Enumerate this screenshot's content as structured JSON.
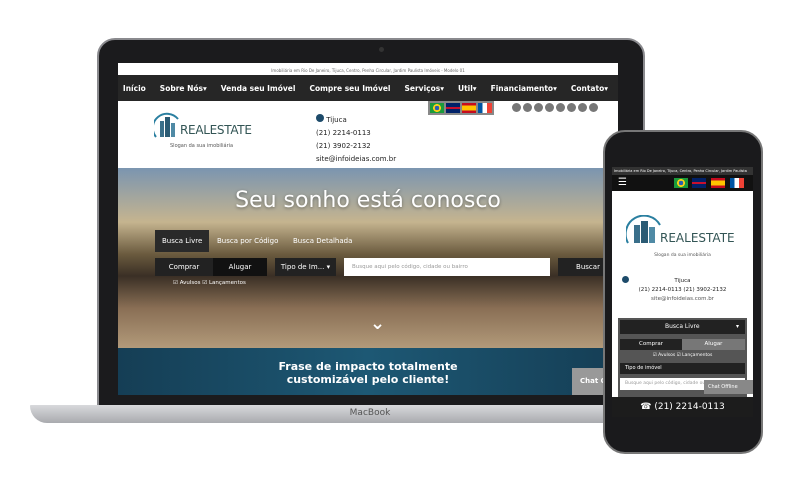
{
  "laptop": {
    "brand": "MacBook",
    "top_strip": "Imobiliária em Rio De Janeiro, Tijuca, Centro, Penha Circular, Jardim Paulista Imóveis - Modelo 01",
    "nav": [
      "Início",
      "Sobre Nós▾",
      "Venda seu Imóvel",
      "Compre seu Imóvel",
      "Serviços▾",
      "Util▾",
      "Financiamento▾",
      "Contato▾"
    ],
    "logo": {
      "text_real": "REAL",
      "text_estate": "ESTATE",
      "slogan": "Slogan da sua imobiliária"
    },
    "contact": {
      "location": "Tijuca",
      "phone1": "(21) 2214-0113",
      "phone2": "(21) 3902-2132",
      "email": "site@infoideias.com.br"
    },
    "flags": [
      "brazil",
      "uk",
      "spain",
      "france"
    ],
    "socials": [
      "facebook",
      "twitter",
      "youtube",
      "linkedin",
      "instagram",
      "pinterest",
      "google-plus",
      "skype"
    ],
    "hero": {
      "title": "Seu sonho está conosco",
      "tabs": [
        "Busca Livre",
        "Busca por Código",
        "Busca Detalhada"
      ],
      "buy": "Comprar",
      "rent": "Alugar",
      "type_select": "Tipo de Im...",
      "search_placeholder": "Busque aqui pelo código, cidade ou bairro",
      "search_button": "Buscar",
      "check1": "Avulsos",
      "check2": "Lançamentos"
    },
    "band": {
      "line1": "Frase de impacto totalmente",
      "line2": "customizável pelo cliente!"
    },
    "chat": "Chat Of"
  },
  "phone": {
    "top_strip": "Imobiliária em Rio De Janeiro, Tijuca, Centro, Penha Circular, Jardim Paulista",
    "location": "Tijuca",
    "phones": "(21) 2214-0113 (21) 3902-2132",
    "email": "site@infoideias.com.br",
    "search_mode": "Busca Livre",
    "buy": "Comprar",
    "rent": "Alugar",
    "check1": "Avulsos",
    "check2": "Lançamentos",
    "type_select": "Tipo de imóvel",
    "search_placeholder": "Busque aqui pelo código, cidade ou bairro",
    "chat": "Chat Offline",
    "bottom_phone": "☎ (21) 2214-0113"
  }
}
